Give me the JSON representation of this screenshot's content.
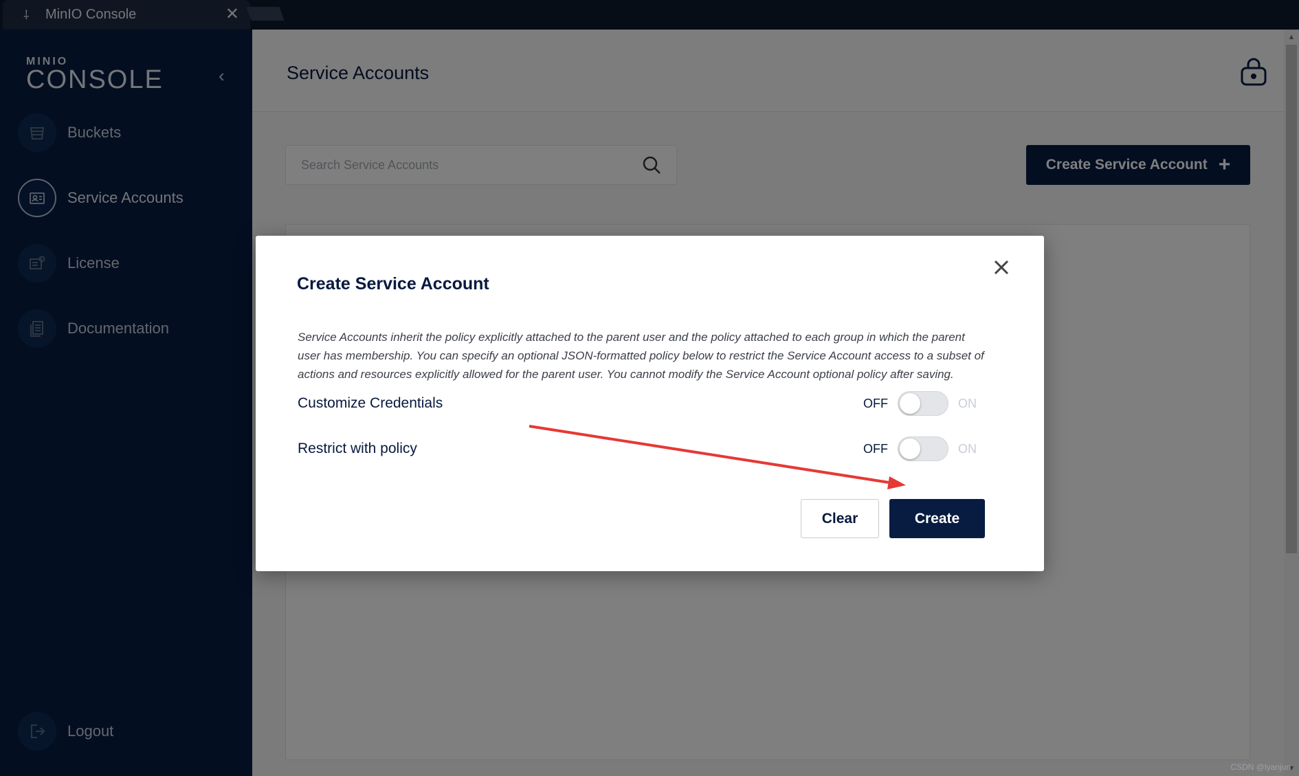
{
  "browser": {
    "tab_title": "MinIO Console",
    "tab_close": "✕"
  },
  "sidebar": {
    "logo_small": "MINIO",
    "logo_big": "CONSOLE",
    "items": [
      {
        "label": "Buckets",
        "icon": "bucket-icon"
      },
      {
        "label": "Service Accounts",
        "icon": "service-account-icon",
        "active": true
      },
      {
        "label": "License",
        "icon": "license-icon"
      },
      {
        "label": "Documentation",
        "icon": "documentation-icon"
      }
    ],
    "logout": {
      "label": "Logout",
      "icon": "logout-icon"
    }
  },
  "main": {
    "title": "Service Accounts",
    "search_placeholder": "Search Service Accounts",
    "create_button": "Create Service Account"
  },
  "modal": {
    "title": "Create Service Account",
    "description": "Service Accounts inherit the policy explicitly attached to the parent user and the policy attached to each group in which the parent user has membership. You can specify an optional JSON-formatted policy below to restrict the Service Account access to a subset of actions and resources explicitly allowed for the parent user. You cannot modify the Service Account optional policy after saving.",
    "toggles": [
      {
        "label": "Customize Credentials",
        "off_label": "OFF",
        "on_label": "ON",
        "value": false
      },
      {
        "label": "Restrict with policy",
        "off_label": "OFF",
        "on_label": "ON",
        "value": false
      }
    ],
    "clear_button": "Clear",
    "create_button": "Create"
  },
  "colors": {
    "brand_dark": "#081c42",
    "annotation_arrow": "#e53935"
  },
  "watermark": "CSDN @lyanjun"
}
